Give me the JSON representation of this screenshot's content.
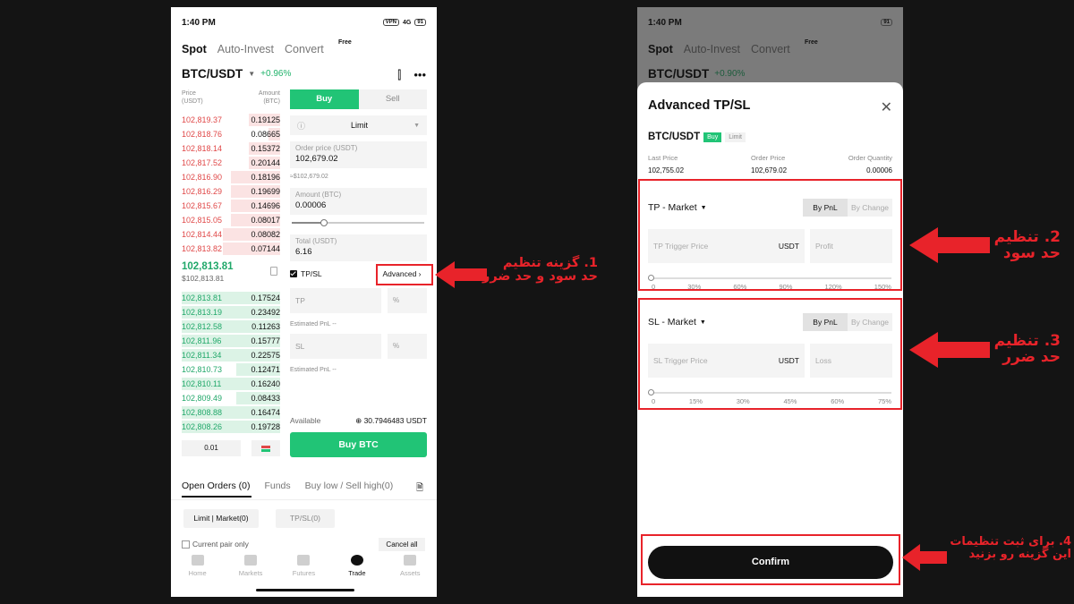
{
  "left_phone": {
    "status_time": "1:40 PM",
    "status_icons": [
      "VPN",
      "4G",
      "91"
    ],
    "tabs": [
      "Spot",
      "Auto-Invest",
      "Convert"
    ],
    "free_badge": "Free",
    "pair": "BTC/USDT",
    "change": "+0.96%",
    "orderbook": {
      "price_header": "Price\n(USDT)",
      "amount_header": "Amount\n(BTC)",
      "asks": [
        {
          "price": "102,819.37",
          "amount": "0.19125",
          "depth": 0.32
        },
        {
          "price": "102,818.76",
          "amount": "0.08665",
          "depth": 0.12
        },
        {
          "price": "102,818.14",
          "amount": "0.15372",
          "depth": 0.32
        },
        {
          "price": "102,817.52",
          "amount": "0.20144",
          "depth": 0.32
        },
        {
          "price": "102,816.90",
          "amount": "0.18196",
          "depth": 0.5
        },
        {
          "price": "102,816.29",
          "amount": "0.19699",
          "depth": 0.5
        },
        {
          "price": "102,815.67",
          "amount": "0.14696",
          "depth": 0.5
        },
        {
          "price": "102,815.05",
          "amount": "0.08017",
          "depth": 0.5
        },
        {
          "price": "102,814.44",
          "amount": "0.08082",
          "depth": 0.58
        },
        {
          "price": "102,813.82",
          "amount": "0.07144",
          "depth": 0.58
        }
      ],
      "mid_price": "102,813.81",
      "mid_usd": "$102,813.81",
      "bids": [
        {
          "price": "102,813.81",
          "amount": "0.17524",
          "depth": 1.0
        },
        {
          "price": "102,813.19",
          "amount": "0.23492",
          "depth": 1.0
        },
        {
          "price": "102,812.58",
          "amount": "0.11263",
          "depth": 1.0
        },
        {
          "price": "102,811.96",
          "amount": "0.15777",
          "depth": 1.0
        },
        {
          "price": "102,811.34",
          "amount": "0.22575",
          "depth": 1.0
        },
        {
          "price": "102,810.73",
          "amount": "0.12471",
          "depth": 0.45
        },
        {
          "price": "102,810.11",
          "amount": "0.16240",
          "depth": 1.0
        },
        {
          "price": "102,809.49",
          "amount": "0.08433",
          "depth": 0.45
        },
        {
          "price": "102,808.88",
          "amount": "0.16474",
          "depth": 1.0
        },
        {
          "price": "102,808.26",
          "amount": "0.19728",
          "depth": 1.0
        }
      ],
      "depth_value": "0.01"
    },
    "form": {
      "buy_label": "Buy",
      "sell_label": "Sell",
      "order_type": "Limit",
      "order_price_label": "Order price (USDT)",
      "order_price_value": "102,679.02",
      "approx": "≈$102,679.02",
      "amount_label": "Amount (BTC)",
      "amount_value": "0.00006",
      "total_label": "Total (USDT)",
      "total_value": "6.16",
      "tpsl_label": "TP/SL",
      "advanced_label": "Advanced",
      "tp_placeholder": "TP",
      "sl_placeholder": "SL",
      "pct": "%",
      "estimated_pnl": "Estimated PnL  --",
      "available_label": "Available",
      "available_value": "30.7946483 USDT",
      "buy_button": "Buy BTC"
    },
    "orders_tabs": [
      "Open Orders (0)",
      "Funds",
      "Buy low / Sell high(0)"
    ],
    "filters": [
      "Limit | Market(0)",
      "TP/SL(0)"
    ],
    "current_pair_only": "Current pair only",
    "cancel_all": "Cancel all",
    "nav": [
      "Home",
      "Markets",
      "Futures",
      "Trade",
      "Assets"
    ]
  },
  "right_phone": {
    "status_time": "1:40 PM",
    "tabs": [
      "Spot",
      "Auto-Invest",
      "Convert"
    ],
    "free_badge": "Free",
    "pair_bg": "BTC/USDT",
    "change_bg": "+0.90%",
    "sheet": {
      "title": "Advanced TP/SL",
      "pair": "BTC/USDT",
      "side_badge": "Buy",
      "type_badge": "Limit",
      "last_price_label": "Last Price",
      "last_price": "102,755.02",
      "order_price_label": "Order Price",
      "order_price": "102,679.02",
      "order_qty_label": "Order Quantity",
      "order_qty": "0.00006",
      "tp": {
        "title": "TP - Market",
        "by_pnl": "By PnL",
        "by_change": "By Change",
        "trigger_placeholder": "TP Trigger Price",
        "unit": "USDT",
        "second_placeholder": "Profit",
        "ticks": [
          "0",
          "30%",
          "60%",
          "90%",
          "120%",
          "150%"
        ]
      },
      "sl": {
        "title": "SL - Market",
        "by_pnl": "By PnL",
        "by_change": "By Change",
        "trigger_placeholder": "SL Trigger Price",
        "unit": "USDT",
        "second_placeholder": "Loss",
        "ticks": [
          "0",
          "15%",
          "30%",
          "45%",
          "60%",
          "75%"
        ]
      },
      "confirm": "Confirm"
    }
  },
  "annotations": {
    "a1_line1": "1. گزینه تنظیم",
    "a1_line2": "حد سود و حد ضرر",
    "a2_line1": "2. تنظیم",
    "a2_line2": "حد سود",
    "a3_line1": "3. تنظیم",
    "a3_line2": "حد ضرر",
    "a4_line1": "4. برای ثبت تنظیمات",
    "a4_line2": "این گزینه رو بزنید"
  },
  "colors": {
    "green": "#21c476",
    "red": "#e04848",
    "annotation": "#e8232a"
  }
}
